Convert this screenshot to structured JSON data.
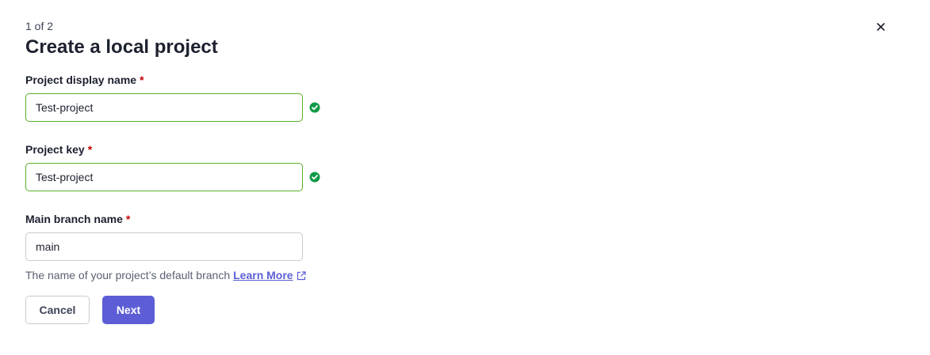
{
  "header": {
    "step": "1 of 2",
    "title": "Create a local project",
    "close_icon": "close-icon"
  },
  "form": {
    "display_name": {
      "label": "Project display name",
      "required_mark": "*",
      "value": "Test-project",
      "status": "valid"
    },
    "project_key": {
      "label": "Project key",
      "required_mark": "*",
      "value": "Test-project",
      "status": "valid"
    },
    "main_branch": {
      "label": "Main branch name",
      "required_mark": "*",
      "value": "main",
      "help": "The name of your project’s default branch",
      "link": "Learn More",
      "link_icon": "external-link-icon"
    }
  },
  "actions": {
    "cancel": "Cancel",
    "next": "Next"
  },
  "colors": {
    "primary": "#5d5ed6",
    "valid_border": "#59b02a",
    "valid_icon": "#0e9a47",
    "required": "#c60000"
  }
}
